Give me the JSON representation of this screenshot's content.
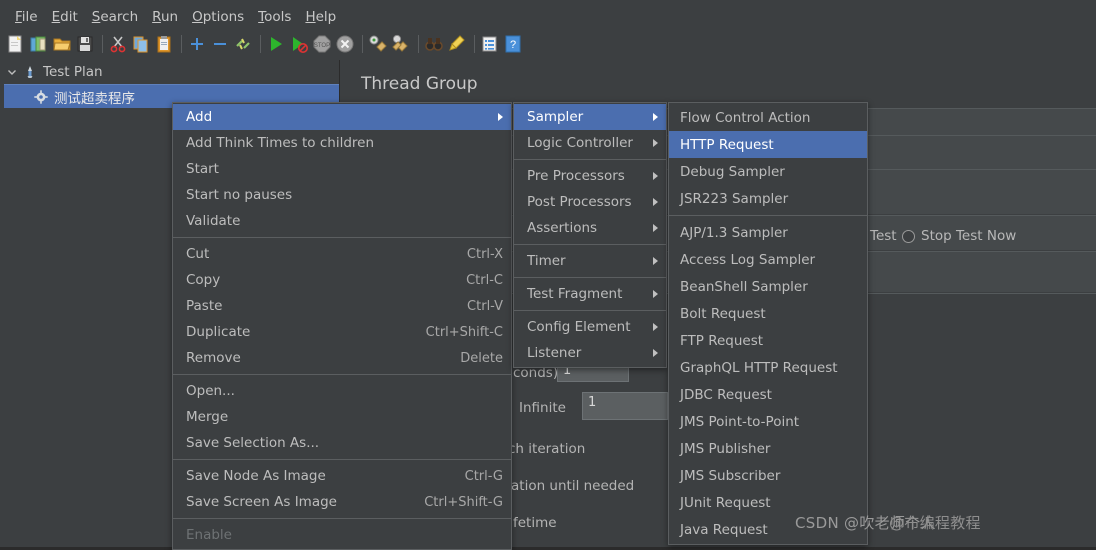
{
  "window": {
    "background": "#3c3f41",
    "accent": "#4b6eaf"
  },
  "menubar": {
    "items": [
      {
        "mnemonic": "F",
        "rest": "ile"
      },
      {
        "mnemonic": "E",
        "rest": "dit"
      },
      {
        "mnemonic": "S",
        "rest": "earch"
      },
      {
        "mnemonic": "R",
        "rest": "un"
      },
      {
        "mnemonic": "O",
        "rest": "ptions"
      },
      {
        "mnemonic": "T",
        "rest": "ools"
      },
      {
        "mnemonic": "H",
        "rest": "elp"
      }
    ]
  },
  "toolbar": {
    "icons": [
      "new-file-icon",
      "new-from-template-icon",
      "open-folder-icon",
      "save-icon",
      "cut-scissors-icon",
      "copy-icon",
      "paste-icon",
      "expand-plus-icon",
      "collapse-minus-icon",
      "toggle-icon",
      "start-play-icon",
      "start-no-pauses-icon",
      "stop-icon",
      "shutdown-icon",
      "clear-icon",
      "clear-all-icon",
      "search-binoculars-icon",
      "reset-search-icon",
      "function-helper-icon",
      "help-icon"
    ]
  },
  "tree": {
    "root": {
      "label": "Test Plan",
      "icon": "test-plan-icon",
      "expanded": true
    },
    "child": {
      "label": "测试超卖程序",
      "icon": "thread-group-gear-icon",
      "selected": true
    }
  },
  "content": {
    "title": "Thread Group",
    "fields": {
      "ramp_up_label": "conds):",
      "ramp_up_value": "1",
      "infinite_label": "Infinite",
      "loop_value": "1",
      "same_user_label": "ch iteration",
      "delay_label": "ation until needed",
      "lifetime_label": "fetime"
    },
    "action_radios": [
      {
        "label": "Test",
        "selected": false
      },
      {
        "label": "Stop Test Now",
        "selected": false
      }
    ]
  },
  "context_menu": {
    "name": "tree-node-context-menu",
    "groups": [
      [
        {
          "label": "Add",
          "submenu": true,
          "selected": true,
          "disabled": false,
          "accel": ""
        },
        {
          "label": "Add Think Times to children",
          "submenu": false,
          "selected": false,
          "disabled": false,
          "accel": ""
        },
        {
          "label": "Start",
          "submenu": false,
          "selected": false,
          "disabled": false,
          "accel": ""
        },
        {
          "label": "Start no pauses",
          "submenu": false,
          "selected": false,
          "disabled": false,
          "accel": ""
        },
        {
          "label": "Validate",
          "submenu": false,
          "selected": false,
          "disabled": false,
          "accel": ""
        }
      ],
      [
        {
          "label": "Cut",
          "submenu": false,
          "selected": false,
          "disabled": false,
          "accel": "Ctrl-X"
        },
        {
          "label": "Copy",
          "submenu": false,
          "selected": false,
          "disabled": false,
          "accel": "Ctrl-C"
        },
        {
          "label": "Paste",
          "submenu": false,
          "selected": false,
          "disabled": false,
          "accel": "Ctrl-V"
        },
        {
          "label": "Duplicate",
          "submenu": false,
          "selected": false,
          "disabled": false,
          "accel": "Ctrl+Shift-C"
        },
        {
          "label": "Remove",
          "submenu": false,
          "selected": false,
          "disabled": false,
          "accel": "Delete"
        }
      ],
      [
        {
          "label": "Open...",
          "submenu": false,
          "selected": false,
          "disabled": false,
          "accel": ""
        },
        {
          "label": "Merge",
          "submenu": false,
          "selected": false,
          "disabled": false,
          "accel": ""
        },
        {
          "label": "Save Selection As...",
          "submenu": false,
          "selected": false,
          "disabled": false,
          "accel": ""
        }
      ],
      [
        {
          "label": "Save Node As Image",
          "submenu": false,
          "selected": false,
          "disabled": false,
          "accel": "Ctrl-G"
        },
        {
          "label": "Save Screen As Image",
          "submenu": false,
          "selected": false,
          "disabled": false,
          "accel": "Ctrl+Shift-G"
        }
      ],
      [
        {
          "label": "Enable",
          "submenu": false,
          "selected": false,
          "disabled": true,
          "accel": ""
        }
      ]
    ]
  },
  "add_submenu": {
    "name": "add-submenu",
    "groups": [
      [
        {
          "label": "Sampler",
          "submenu": true,
          "selected": true
        },
        {
          "label": "Logic Controller",
          "submenu": true,
          "selected": false
        }
      ],
      [
        {
          "label": "Pre Processors",
          "submenu": true,
          "selected": false
        },
        {
          "label": "Post Processors",
          "submenu": true,
          "selected": false
        },
        {
          "label": "Assertions",
          "submenu": true,
          "selected": false
        }
      ],
      [
        {
          "label": "Timer",
          "submenu": true,
          "selected": false
        }
      ],
      [
        {
          "label": "Test Fragment",
          "submenu": true,
          "selected": false
        }
      ],
      [
        {
          "label": "Config Element",
          "submenu": true,
          "selected": false
        },
        {
          "label": "Listener",
          "submenu": true,
          "selected": false
        }
      ]
    ]
  },
  "sampler_submenu": {
    "name": "sampler-submenu",
    "groups": [
      [
        {
          "label": "Flow Control Action",
          "selected": false
        },
        {
          "label": "HTTP Request",
          "selected": true
        },
        {
          "label": "Debug Sampler",
          "selected": false
        },
        {
          "label": "JSR223 Sampler",
          "selected": false
        }
      ],
      [
        {
          "label": "AJP/1.3 Sampler",
          "selected": false
        },
        {
          "label": "Access Log Sampler",
          "selected": false
        },
        {
          "label": "BeanShell Sampler",
          "selected": false
        },
        {
          "label": "Bolt Request",
          "selected": false
        },
        {
          "label": "FTP Request",
          "selected": false
        },
        {
          "label": "GraphQL HTTP Request",
          "selected": false
        },
        {
          "label": "JDBC Request",
          "selected": false
        },
        {
          "label": "JMS Point-to-Point",
          "selected": false
        },
        {
          "label": "JMS Publisher",
          "selected": false
        },
        {
          "label": "JMS Subscriber",
          "selected": false
        },
        {
          "label": "JUnit Request",
          "selected": false
        },
        {
          "label": "Java Request",
          "selected": false
        }
      ]
    ]
  },
  "watermark": {
    "line1": "CSDN @吹老师个人",
    "line2": "@布编程教程"
  }
}
